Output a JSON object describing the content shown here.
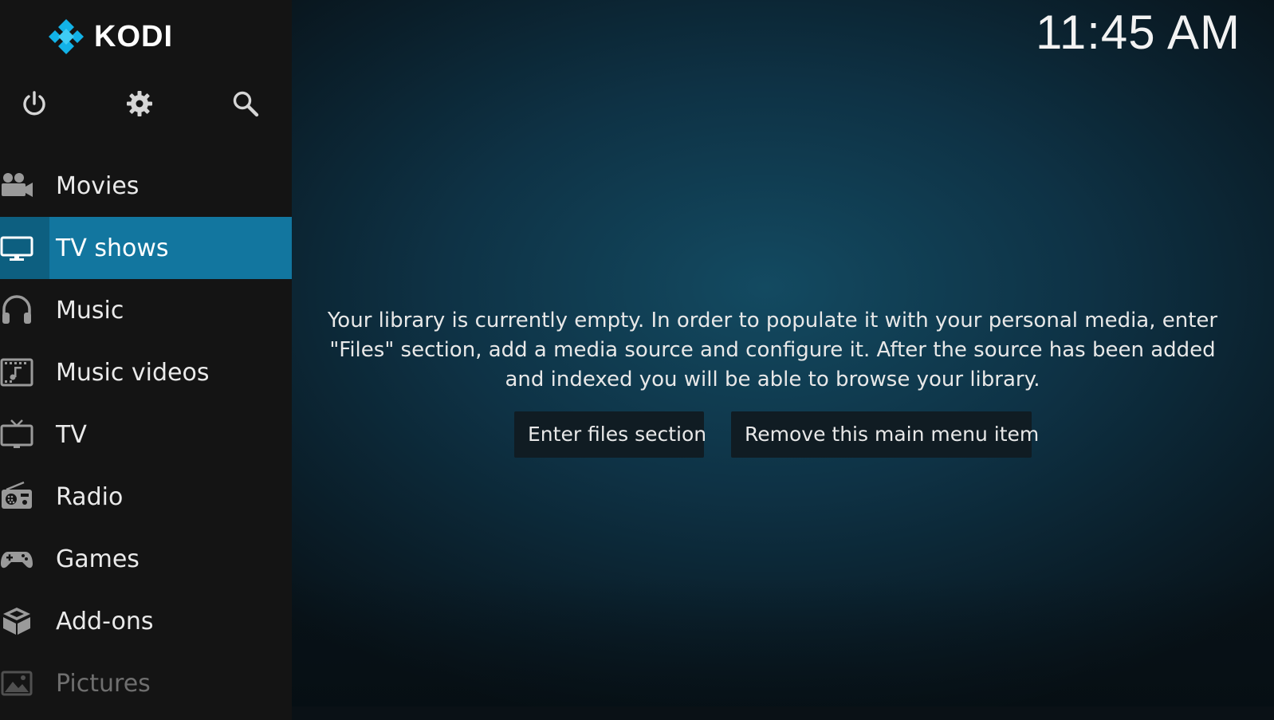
{
  "app": {
    "logo_text": "KODI",
    "clock": "11:45 AM",
    "accent_color": "#12769f",
    "logo_color": "#12b2e7"
  },
  "quick_actions": [
    {
      "icon": "power-icon"
    },
    {
      "icon": "gear-icon"
    },
    {
      "icon": "search-icon"
    }
  ],
  "menu": [
    {
      "label": "Movies",
      "icon": "movie-camera-icon"
    },
    {
      "label": "TV shows",
      "icon": "monitor-icon",
      "selected": true
    },
    {
      "label": "Music",
      "icon": "headphones-icon"
    },
    {
      "label": "Music videos",
      "icon": "music-video-icon"
    },
    {
      "label": "TV",
      "icon": "tv-icon"
    },
    {
      "label": "Radio",
      "icon": "radio-icon"
    },
    {
      "label": "Games",
      "icon": "gamepad-icon"
    },
    {
      "label": "Add-ons",
      "icon": "addons-box-icon"
    },
    {
      "label": "Pictures",
      "icon": "picture-icon"
    }
  ],
  "main": {
    "message": "Your library is currently empty. In order to populate it with your personal media, enter \"Files\" section, add a media source and configure it. After the source has been added and indexed you will be able to browse your library.",
    "buttons": {
      "enter_files": "Enter files section",
      "remove_item": "Remove this main menu item"
    }
  }
}
